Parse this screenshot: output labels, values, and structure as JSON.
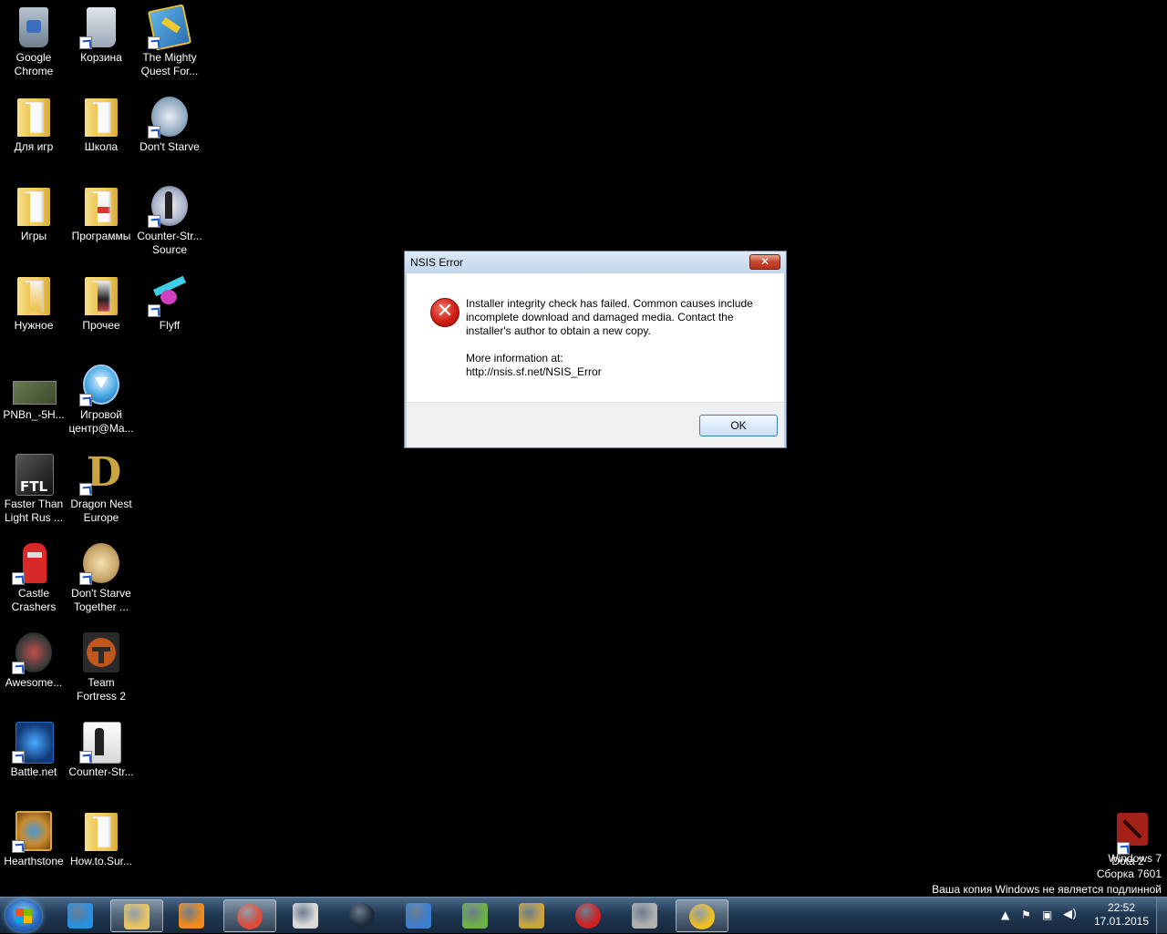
{
  "desktop": {
    "icons": [
      {
        "label": "Google Chrome",
        "icon": "recycle-bin-full-icon"
      },
      {
        "label": "Корзина",
        "icon": "recycle-bin-empty-icon"
      },
      {
        "label": "The Mighty Quest For...",
        "icon": "mighty-quest-icon"
      },
      {
        "label": "Для игр",
        "icon": "folder-icon"
      },
      {
        "label": "Школа",
        "icon": "folder-icon"
      },
      {
        "label": "Don't Starve",
        "icon": "dont-starve-icon"
      },
      {
        "label": "Игры",
        "icon": "folder-icon"
      },
      {
        "label": "Программы",
        "icon": "folder-icon"
      },
      {
        "label": "Counter-Str... Source",
        "icon": "counter-strike-source-icon"
      },
      {
        "label": "Нужное",
        "icon": "folder-icon"
      },
      {
        "label": "Прочее",
        "icon": "folder-icon"
      },
      {
        "label": "Flyff",
        "icon": "flyff-icon"
      },
      {
        "label": "PNBn_-5H...",
        "icon": "image-thumbnail-icon"
      },
      {
        "label": "Игровой центр@Ma...",
        "icon": "game-center-icon"
      },
      {
        "label": "Faster Than Light Rus ...",
        "icon": "ftl-icon"
      },
      {
        "label": "Dragon Nest Europe",
        "icon": "dragon-nest-icon"
      },
      {
        "label": "Castle Crashers",
        "icon": "castle-crashers-icon"
      },
      {
        "label": "Don't Starve Together ...",
        "icon": "dont-starve-together-icon"
      },
      {
        "label": "Awesome...",
        "icon": "awesomenauts-icon"
      },
      {
        "label": "Team Fortress 2",
        "icon": "team-fortress-2-icon"
      },
      {
        "label": "Battle.net",
        "icon": "battle-net-icon"
      },
      {
        "label": "Counter-Str...",
        "icon": "counter-strike-icon"
      },
      {
        "label": "Hearthstone",
        "icon": "hearthstone-icon"
      },
      {
        "label": "How.to.Sur...",
        "icon": "folder-icon"
      },
      {
        "label": "Dota 2",
        "icon": "dota-2-icon"
      }
    ]
  },
  "dialog": {
    "title": "NSIS Error",
    "close_glyph": "✕",
    "message": "Installer integrity check has failed. Common causes include incomplete download and damaged media. Contact the installer's author to obtain a new copy.",
    "more_info": "More information at:",
    "url": "http://nsis.sf.net/NSIS_Error",
    "ok_label": "OK"
  },
  "watermark": {
    "line1": "Windows 7",
    "line2": "Сборка 7601",
    "line3": "Ваша копия Windows не является подлинной"
  },
  "taskbar": {
    "pinned": [
      {
        "name": "internet-explorer-icon",
        "color": "#2a8fe0"
      },
      {
        "name": "explorer-icon",
        "color": "#e7c563"
      },
      {
        "name": "media-player-icon",
        "color": "#f08a1c"
      },
      {
        "name": "chrome-icon",
        "color": "#dd4b39"
      },
      {
        "name": "counter-strike-icon",
        "color": "#d9d9d9"
      },
      {
        "name": "steam-icon",
        "color": "#1b2838"
      },
      {
        "name": "thunderbird-icon",
        "color": "#3c7fd0"
      },
      {
        "name": "control-panel-icon",
        "color": "#6fb04a"
      },
      {
        "name": "security-shield-icon",
        "color": "#c9a441"
      },
      {
        "name": "agent-icon",
        "color": "#d02020"
      },
      {
        "name": "counter-strike-go-icon",
        "color": "#b0b0b0"
      },
      {
        "name": "nsis-installer-icon",
        "color": "#f0c020"
      }
    ],
    "clock": {
      "time": "22:52",
      "date": "17.01.2015"
    }
  }
}
